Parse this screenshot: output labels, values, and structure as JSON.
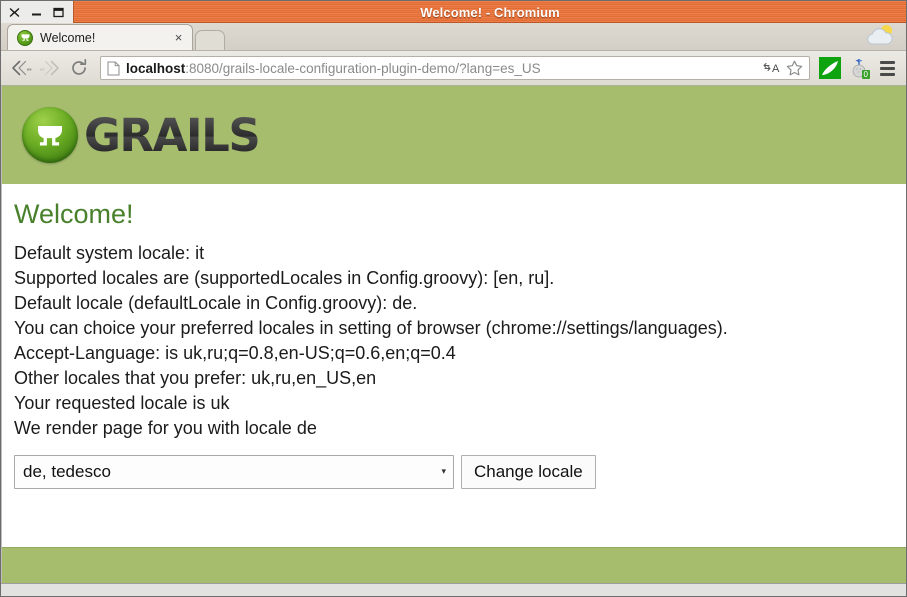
{
  "window": {
    "title": "Welcome! - Chromium",
    "controls": {
      "close": "close-window",
      "minimize": "minimize-window",
      "maximize": "maximize-window"
    }
  },
  "browser": {
    "tab": {
      "title": "Welcome!",
      "close_label": "×",
      "favicon": "grails-favicon"
    },
    "new_tab_label": "",
    "toolbar": {
      "back": "back-icon",
      "forward": "forward-icon",
      "reload": "reload-icon",
      "url_host": "localhost",
      "url_rest": ":8080/grails-locale-configuration-plugin-demo/?lang=es_US",
      "url_full": "localhost:8080/grails-locale-configuration-plugin-demo/?lang=es_US",
      "translate": "translate-icon",
      "bookmark": "star-icon",
      "extension_1": "green-swoosh-extension-icon",
      "extension_2": "golf-ball-extension-icon",
      "extension_2_badge": "0",
      "menu": "hamburger-menu-icon"
    }
  },
  "page": {
    "brand": {
      "wordmark": "GRAILS",
      "mark": "grails-chalice-logo"
    },
    "heading": "Welcome!",
    "lines": [
      "Default system locale: it",
      "Supported locales are (supportedLocales in Config.groovy): [en, ru].",
      "Default locale (defaultLocale in Config.groovy): de.",
      "You can choice your preferred locales in setting of browser (chrome://settings/languages).",
      "Accept-Language: is uk,ru;q=0.8,en-US;q=0.6,en;q=0.4",
      "Other locales that you prefer: uk,ru,en_US,en",
      "Your requested locale is uk",
      "We render page for you with locale de"
    ],
    "form": {
      "select_value": "de, tedesco",
      "select_arrow": "▾",
      "submit_label": "Change locale"
    },
    "colors": {
      "band_green": "#a6bd6e",
      "heading_green": "#48802c",
      "titlebar_orange": "#e3703a"
    }
  }
}
